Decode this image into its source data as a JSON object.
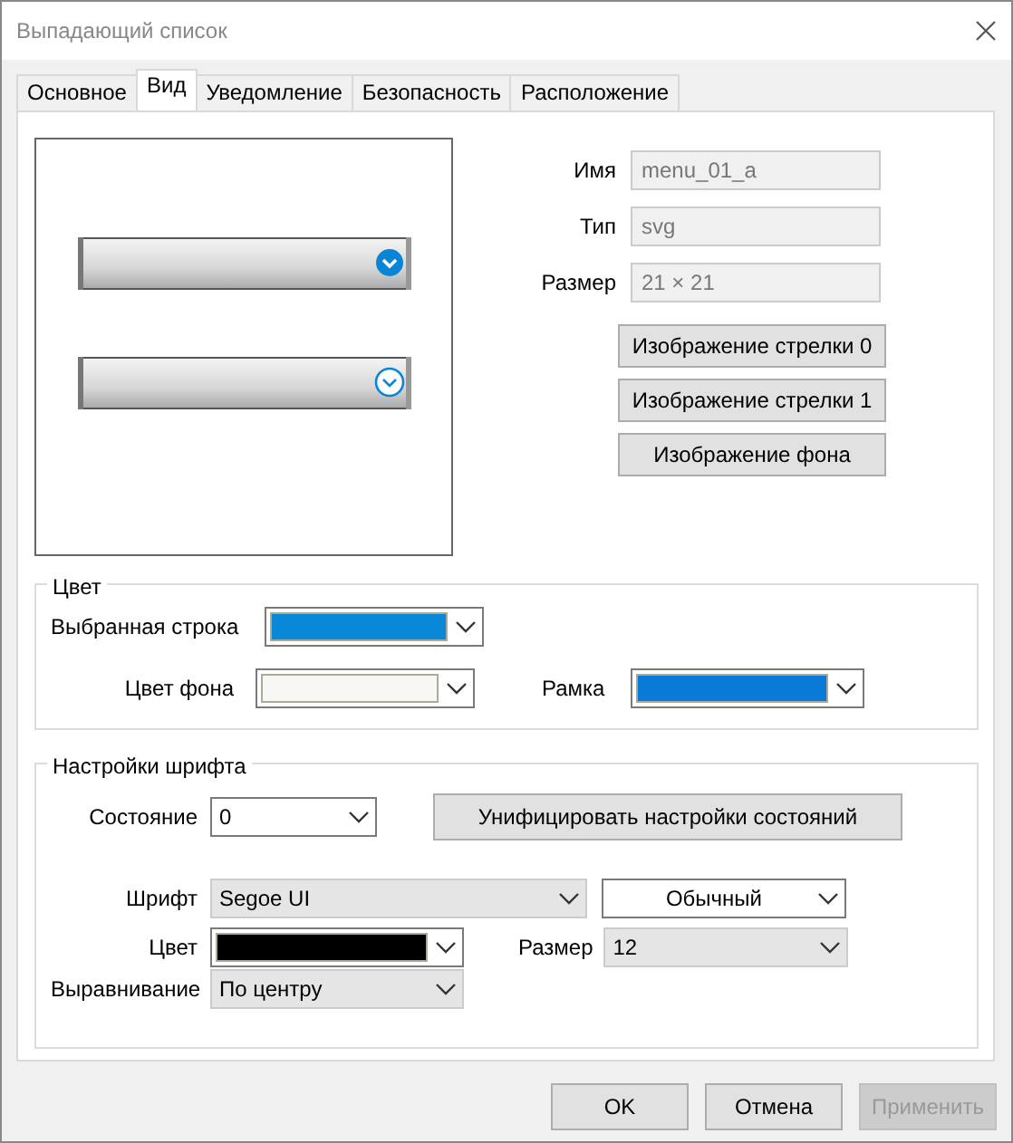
{
  "window": {
    "title": "Выпадающий список"
  },
  "tabs": [
    {
      "label": "Основное",
      "selected": false
    },
    {
      "label": "Вид",
      "selected": true
    },
    {
      "label": "Уведомление",
      "selected": false
    },
    {
      "label": "Безопасность",
      "selected": false
    },
    {
      "label": "Расположение",
      "selected": false
    }
  ],
  "image_info": [
    {
      "label": "Имя",
      "value": "menu_01_a",
      "disabled": true
    },
    {
      "label": "Тип",
      "value": "svg",
      "disabled": true
    },
    {
      "label": "Размер",
      "value": "21 × 21",
      "disabled": true
    }
  ],
  "image_buttons": [
    "Изображение стрелки 0",
    "Изображение стрелки 1",
    "Изображение фона"
  ],
  "color_group": {
    "title": "Цвет",
    "fields": [
      {
        "label": "Выбранная строка",
        "color": "#0a88d8"
      },
      {
        "label": "Цвет фона",
        "color": "#f8f7f3"
      },
      {
        "label": "Рамка",
        "color": "#0a7ad7"
      }
    ]
  },
  "font_group": {
    "title": "Настройки шрифта",
    "state": {
      "label": "Состояние",
      "value": "0",
      "kind": "edit"
    },
    "unify_button": "Унифицировать настройки состояний",
    "font": {
      "label": "Шрифт",
      "value": "Segoe UI",
      "kind": "list"
    },
    "style": {
      "value": "Обычный",
      "kind": "edit"
    },
    "color": {
      "label": "Цвет",
      "color": "#000000"
    },
    "size": {
      "label": "Размер",
      "value": "12",
      "kind": "list"
    },
    "align": {
      "label": "Выравнивание",
      "value": "По центру",
      "kind": "list"
    }
  },
  "footer_buttons": [
    {
      "label": "OK",
      "disabled": false
    },
    {
      "label": "Отмена",
      "disabled": false
    },
    {
      "label": "Применить",
      "disabled": true
    }
  ]
}
